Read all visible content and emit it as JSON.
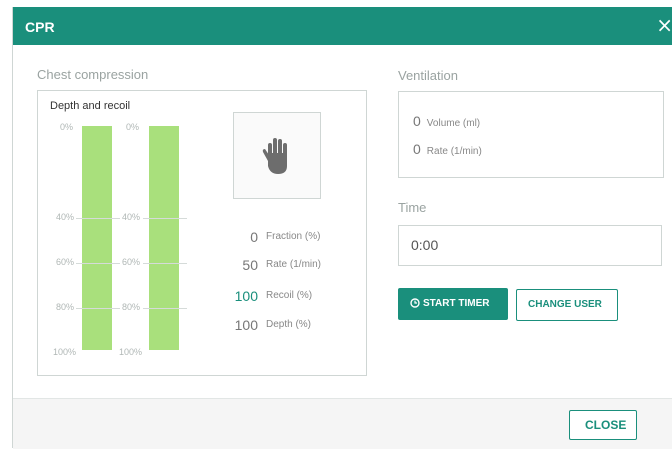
{
  "dialog": {
    "title": "CPR",
    "close_icon": "×"
  },
  "chest": {
    "section_label": "Chest compression",
    "depth_recoil_title": "Depth and recoil",
    "bar_color": "#a9e07c",
    "ticks": [
      "0%",
      "40%",
      "60%",
      "80%",
      "100%"
    ],
    "hand_icon": "hand-icon",
    "stats": [
      {
        "value": "0",
        "label": "Fraction (%)"
      },
      {
        "value": "50",
        "label": "Rate (1/min)"
      },
      {
        "value": "100",
        "label": "Recoil (%)"
      },
      {
        "value": "100",
        "label": "Depth (%)"
      }
    ]
  },
  "ventilation": {
    "section_label": "Ventilation",
    "rows": [
      {
        "value": "0",
        "label": "Volume (ml)"
      },
      {
        "value": "0",
        "label": "Rate (1/min)"
      }
    ]
  },
  "time": {
    "section_label": "Time",
    "value": "0:00"
  },
  "buttons": {
    "start_timer": "START TIMER",
    "change_user": "CHANGE USER",
    "close": "CLOSE"
  },
  "colors": {
    "accent": "#1a8f7c"
  }
}
